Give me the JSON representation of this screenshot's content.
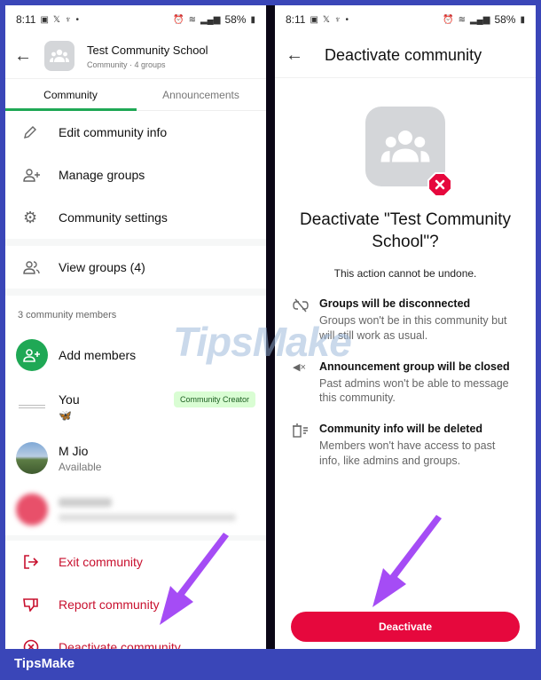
{
  "status_bar": {
    "time": "8:11",
    "battery": "58%"
  },
  "left_screen": {
    "header": {
      "title": "Test Community School",
      "subtitle": "Community · 4 groups"
    },
    "tabs": [
      {
        "label": "Community",
        "active": true
      },
      {
        "label": "Announcements",
        "active": false
      }
    ],
    "menu_items": [
      {
        "label": "Edit community info",
        "icon": "pencil-icon"
      },
      {
        "label": "Manage groups",
        "icon": "manage-groups-icon"
      },
      {
        "label": "Community settings",
        "icon": "gear-icon"
      }
    ],
    "view_groups": {
      "label": "View groups (4)",
      "icon": "groups-icon"
    },
    "members_section": {
      "label": "3 community members",
      "add_members_label": "Add members",
      "members": [
        {
          "name": "You",
          "status": "🦋",
          "badge": "Community Creator"
        },
        {
          "name": "M Jio",
          "status": "Available"
        },
        {
          "name": "(blurred)",
          "status": "(blurred)"
        }
      ]
    },
    "actions": [
      {
        "label": "Exit community",
        "icon": "exit-icon"
      },
      {
        "label": "Report community",
        "icon": "thumbs-down-icon"
      },
      {
        "label": "Deactivate community",
        "icon": "x-circle-icon"
      }
    ]
  },
  "right_screen": {
    "header": {
      "title": "Deactivate community"
    },
    "question": "Deactivate \"Test Community School\"?",
    "warning": "This action cannot be undone.",
    "info_items": [
      {
        "title": "Groups will be disconnected",
        "desc": "Groups won't be in this community but will still work as usual.",
        "icon": "unlink-icon"
      },
      {
        "title": "Announcement group will be closed",
        "desc": "Past admins won't be able to message this community.",
        "icon": "muted-megaphone-icon"
      },
      {
        "title": "Community info will be deleted",
        "desc": "Members won't have access to past info, like admins and groups.",
        "icon": "delete-info-icon"
      }
    ],
    "deactivate_button": "Deactivate"
  },
  "branding": {
    "footer": "TipsMake",
    "watermark": "TipsMake"
  },
  "colors": {
    "frame": "#3a46b8",
    "accent_green": "#1fa855",
    "danger_red": "#e6083d",
    "arrow_purple": "#a54cf5"
  }
}
